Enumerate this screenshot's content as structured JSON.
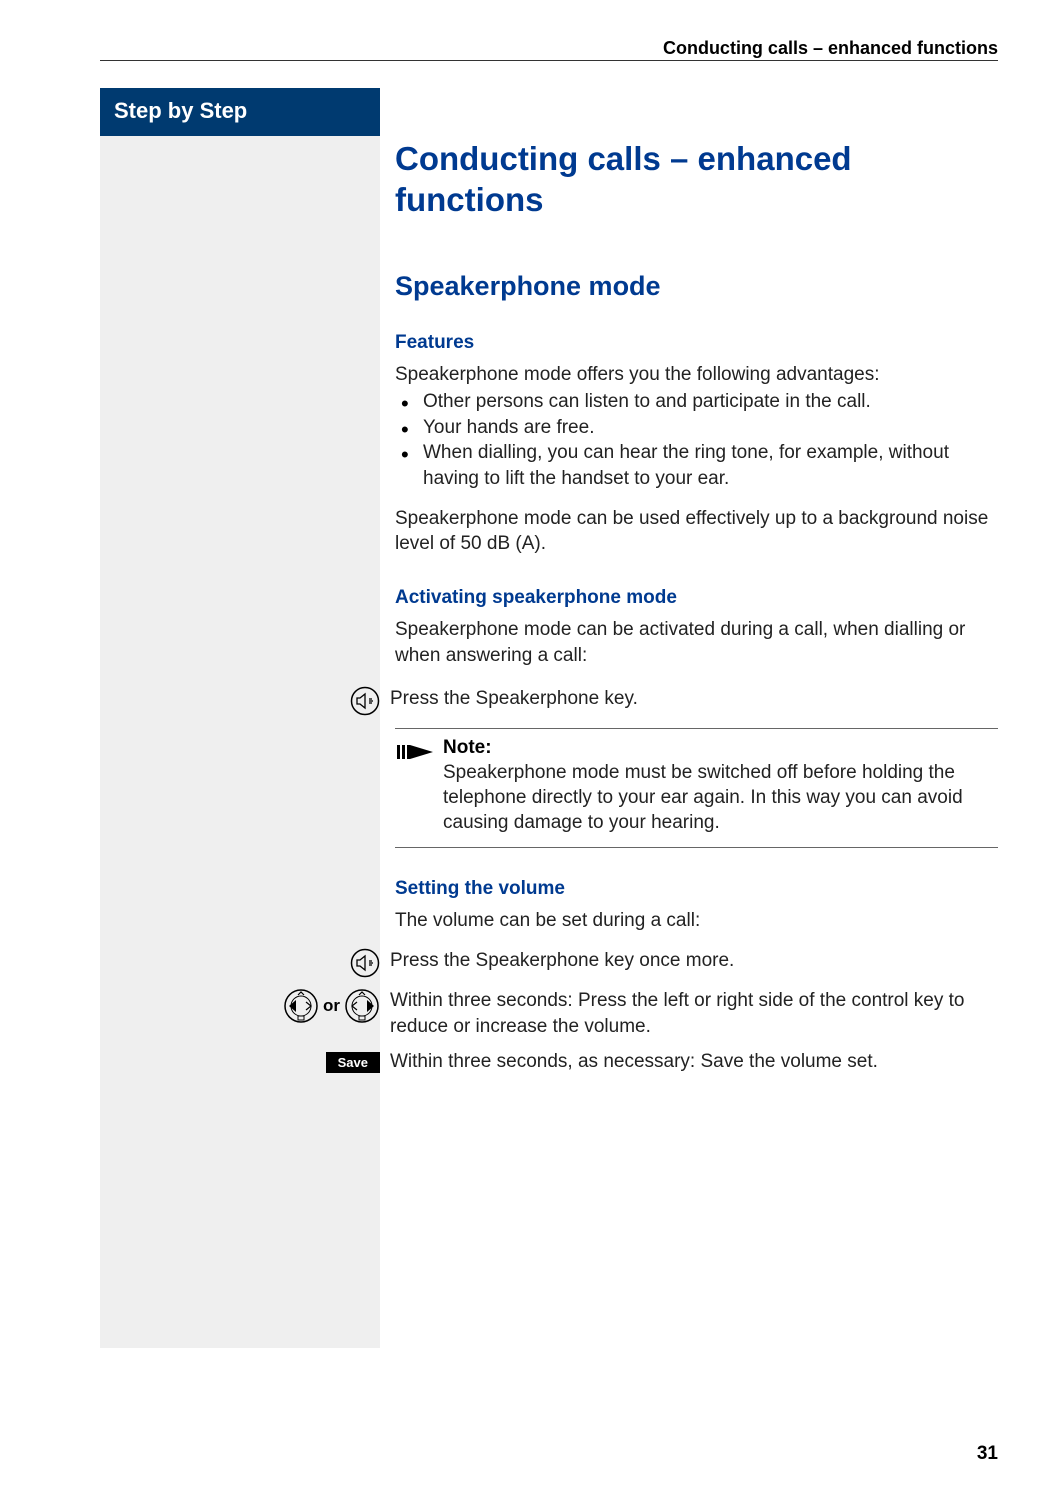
{
  "header": {
    "running_title": "Conducting calls – enhanced functions"
  },
  "sidebar": {
    "title": "Step by Step"
  },
  "content": {
    "h1": "Conducting calls – enhanced functions",
    "h2": "Speakerphone mode",
    "features": {
      "heading": "Features",
      "intro": "Speakerphone mode offers you the following advantages:",
      "bullets": [
        "Other persons can listen to and participate in the call.",
        "Your hands are free.",
        "When dialling, you can hear the ring tone, for  example, without having to lift the handset to your ear."
      ],
      "after": "Speakerphone mode can be used effectively up to a background noise level of 50 dB (A)."
    },
    "activating": {
      "heading": "Activating speakerphone mode",
      "intro": "Speakerphone mode can be activated during a call, when dialling or when answering a call:",
      "step1": "Press the Speakerphone key.",
      "note_title": "Note:",
      "note_body": "Speakerphone mode must be switched off before holding the telephone directly to your ear again. In this way you can avoid causing damage to your hearing."
    },
    "volume": {
      "heading": "Setting the volume",
      "intro": "The volume can be set during a call:",
      "step1": "Press the Speakerphone key once more.",
      "or_label": "or",
      "step2": "Within three seconds: Press the left or right side of the control key to reduce or increase the volume.",
      "save_label": "Save",
      "step3": "Within three seconds, as necessary: Save the volume set."
    }
  },
  "page_number": "31"
}
